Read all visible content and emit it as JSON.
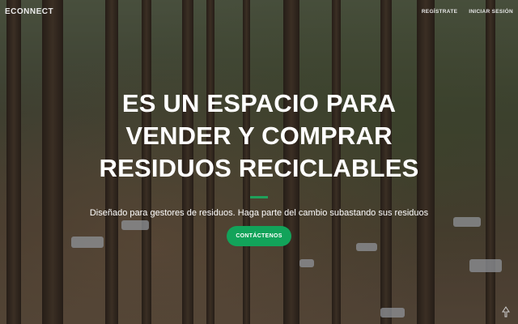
{
  "nav": {
    "brand": "ECONNECT",
    "links": [
      "REGÍSTRATE",
      "INICIAR SESIÓN"
    ]
  },
  "hero": {
    "headline": "ES UN ESPACIO PARA VENDER Y COMPRAR RESIDUOS RECICLABLES",
    "subtitle": "Diseñado para gestores de residuos. Haga parte del cambio subastando sus residuos",
    "cta_label": "CONTÁCTENOS"
  },
  "colors": {
    "accent": "#12a35a",
    "text": "#ffffff"
  },
  "icons": {
    "corner": "scroll-icon"
  }
}
